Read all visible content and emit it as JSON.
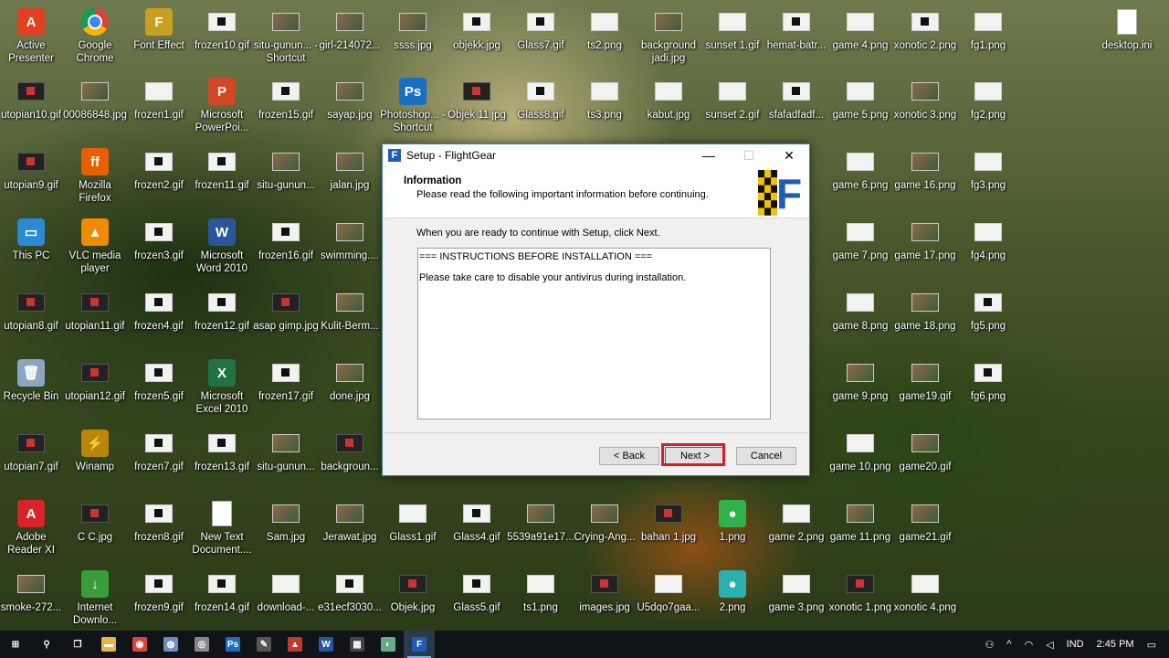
{
  "desktop": {
    "icons": [
      {
        "label": "Active Presenter",
        "kind": "app",
        "color": "#e04020",
        "glyph": "A"
      },
      {
        "label": "Google Chrome",
        "kind": "chrome"
      },
      {
        "label": "Font Effect",
        "kind": "app",
        "color": "#c8a020",
        "glyph": "F"
      },
      {
        "label": "frozen10.gif",
        "kind": "gif"
      },
      {
        "label": "situ-gunun... - Shortcut",
        "kind": "photo"
      },
      {
        "label": "girl-214072...",
        "kind": "photo"
      },
      {
        "label": "ssss.jpg",
        "kind": "photo"
      },
      {
        "label": "objekk.jpg",
        "kind": "gif"
      },
      {
        "label": "Glass7.gif",
        "kind": "gif"
      },
      {
        "label": "ts2.png",
        "kind": "png"
      },
      {
        "label": "background jadi.jpg",
        "kind": "photo"
      },
      {
        "label": "sunset 1.gif",
        "kind": "png"
      },
      {
        "label": "hemat-batr...",
        "kind": "gif"
      },
      {
        "label": "game 4.png",
        "kind": "png"
      },
      {
        "label": "xonotic 2.png",
        "kind": "gif"
      },
      {
        "label": "fg1.png",
        "kind": "png"
      },
      {
        "label": "desktop.ini",
        "kind": "file"
      },
      {
        "label": "utopian10.gif",
        "kind": "dark"
      },
      {
        "label": "00086848.jpg",
        "kind": "photo"
      },
      {
        "label": "frozen1.gif",
        "kind": "png"
      },
      {
        "label": "Microsoft PowerPoi...",
        "kind": "app",
        "color": "#d24726",
        "glyph": "P"
      },
      {
        "label": "frozen15.gif",
        "kind": "gif"
      },
      {
        "label": "sayap.jpg",
        "kind": "photo"
      },
      {
        "label": "Photoshop... - Shortcut",
        "kind": "app",
        "color": "#1a6fc4",
        "glyph": "Ps"
      },
      {
        "label": "Objek 11.jpg",
        "kind": "dark"
      },
      {
        "label": "Glass8.gif",
        "kind": "gif"
      },
      {
        "label": "ts3.png",
        "kind": "png"
      },
      {
        "label": "kabut.jpg",
        "kind": "png"
      },
      {
        "label": "sunset 2.gif",
        "kind": "png"
      },
      {
        "label": "sfafadfadf...",
        "kind": "gif"
      },
      {
        "label": "game 5.png",
        "kind": "png"
      },
      {
        "label": "xonotic 3.png",
        "kind": "photo"
      },
      {
        "label": "fg2.png",
        "kind": "png"
      },
      {
        "label": "utopian9.gif",
        "kind": "dark"
      },
      {
        "label": "Mozilla Firefox",
        "kind": "app",
        "color": "#e66000",
        "glyph": "ff"
      },
      {
        "label": "frozen2.gif",
        "kind": "gif"
      },
      {
        "label": "frozen11.gif",
        "kind": "gif"
      },
      {
        "label": "situ-gunun...",
        "kind": "photo"
      },
      {
        "label": "jalan.jpg",
        "kind": "photo"
      },
      {
        "label": "game 6.png",
        "kind": "png"
      },
      {
        "label": "game 16.png",
        "kind": "photo"
      },
      {
        "label": "fg3.png",
        "kind": "png"
      },
      {
        "label": "This PC",
        "kind": "app",
        "color": "#2a8ad4",
        "glyph": "▭"
      },
      {
        "label": "VLC media player",
        "kind": "app",
        "color": "#f08a00",
        "glyph": "▲"
      },
      {
        "label": "frozen3.gif",
        "kind": "gif"
      },
      {
        "label": "Microsoft Word 2010",
        "kind": "app",
        "color": "#2b579a",
        "glyph": "W"
      },
      {
        "label": "frozen16.gif",
        "kind": "gif"
      },
      {
        "label": "swimming....",
        "kind": "photo"
      },
      {
        "label": "game 7.png",
        "kind": "png"
      },
      {
        "label": "game 17.png",
        "kind": "photo"
      },
      {
        "label": "fg4.png",
        "kind": "png"
      },
      {
        "label": "utopian8.gif",
        "kind": "dark"
      },
      {
        "label": "utopian11.gif",
        "kind": "dark"
      },
      {
        "label": "frozen4.gif",
        "kind": "gif"
      },
      {
        "label": "frozen12.gif",
        "kind": "gif"
      },
      {
        "label": "asap gimp.jpg",
        "kind": "dark"
      },
      {
        "label": "Kulit-Berm...",
        "kind": "photo"
      },
      {
        "label": "game 8.png",
        "kind": "png"
      },
      {
        "label": "game 18.png",
        "kind": "photo"
      },
      {
        "label": "fg5.png",
        "kind": "gif"
      },
      {
        "label": "Recycle Bin",
        "kind": "app",
        "color": "#8aa6c0",
        "glyph": "🗑"
      },
      {
        "label": "utopian12.gif",
        "kind": "dark"
      },
      {
        "label": "frozen5.gif",
        "kind": "gif"
      },
      {
        "label": "Microsoft Excel 2010",
        "kind": "app",
        "color": "#217346",
        "glyph": "X"
      },
      {
        "label": "frozen17.gif",
        "kind": "gif"
      },
      {
        "label": "done.jpg",
        "kind": "photo"
      },
      {
        "label": "game 9.png",
        "kind": "photo"
      },
      {
        "label": "game19.gif",
        "kind": "photo"
      },
      {
        "label": "fg6.png",
        "kind": "gif"
      },
      {
        "label": "utopian7.gif",
        "kind": "dark"
      },
      {
        "label": "Winamp",
        "kind": "app",
        "color": "#b8860b",
        "glyph": "⚡"
      },
      {
        "label": "frozen7.gif",
        "kind": "gif"
      },
      {
        "label": "frozen13.gif",
        "kind": "gif"
      },
      {
        "label": "situ-gunun...",
        "kind": "photo"
      },
      {
        "label": "backgroun...",
        "kind": "dark"
      },
      {
        "label": "game 10.png",
        "kind": "png"
      },
      {
        "label": "game20.gif",
        "kind": "photo"
      },
      {
        "label": "Adobe Reader XI",
        "kind": "app",
        "color": "#d8232a",
        "glyph": "A"
      },
      {
        "label": "C C.jpg",
        "kind": "dark"
      },
      {
        "label": "frozen8.gif",
        "kind": "gif"
      },
      {
        "label": "New Text Document....",
        "kind": "file"
      },
      {
        "label": "Sam.jpg",
        "kind": "photo"
      },
      {
        "label": "Jerawat.jpg",
        "kind": "photo"
      },
      {
        "label": "Glass1.gif",
        "kind": "png"
      },
      {
        "label": "Glass4.gif",
        "kind": "gif"
      },
      {
        "label": "5539a91e17...",
        "kind": "photo"
      },
      {
        "label": "Crying-Ang...",
        "kind": "photo"
      },
      {
        "label": "bahan 1.jpg",
        "kind": "dark"
      },
      {
        "label": "1.png",
        "kind": "app",
        "color": "#2fb24a",
        "glyph": "●"
      },
      {
        "label": "game 2.png",
        "kind": "png"
      },
      {
        "label": "game 11.png",
        "kind": "photo"
      },
      {
        "label": "game21.gif",
        "kind": "photo"
      },
      {
        "label": "smoke-272...",
        "kind": "photo"
      },
      {
        "label": "Internet Downlo...",
        "kind": "app",
        "color": "#3a9c3a",
        "glyph": "↓"
      },
      {
        "label": "frozen9.gif",
        "kind": "gif"
      },
      {
        "label": "frozen14.gif",
        "kind": "gif"
      },
      {
        "label": "download-...",
        "kind": "png"
      },
      {
        "label": "e31ecf3030...",
        "kind": "gif"
      },
      {
        "label": "Objek.jpg",
        "kind": "dark"
      },
      {
        "label": "Glass5.gif",
        "kind": "gif"
      },
      {
        "label": "ts1.png",
        "kind": "png"
      },
      {
        "label": "images.jpg",
        "kind": "dark"
      },
      {
        "label": "U5dqo7gaa...",
        "kind": "png"
      },
      {
        "label": "2.png",
        "kind": "app",
        "color": "#2ab0b0",
        "glyph": "●"
      },
      {
        "label": "game 3.png",
        "kind": "png"
      },
      {
        "label": "xonotic 1.png",
        "kind": "dark"
      },
      {
        "label": "xonotic 4.png",
        "kind": "png"
      }
    ]
  },
  "dialog": {
    "title": "Setup - FlightGear",
    "icon_letter": "F",
    "controls": {
      "minimize": "—",
      "maximize": "☐",
      "close": "✕"
    },
    "header_title": "Information",
    "header_subtitle": "Please read the following important information before continuing.",
    "intro": "When you are ready to continue with Setup, click Next.",
    "memo_lines": [
      "=== INSTRUCTIONS BEFORE INSTALLATION ===",
      "Please take care to disable your antivirus during installation."
    ],
    "buttons": {
      "back": "< Back",
      "next": "Next >",
      "cancel": "Cancel"
    },
    "logo_letter": "F",
    "highlight_color": "#e11b22"
  },
  "taskbar": {
    "items": [
      {
        "name": "start-button",
        "glyph": "⊞",
        "color": "#101418"
      },
      {
        "name": "search-icon",
        "glyph": "⚲",
        "color": "#101418"
      },
      {
        "name": "task-view-icon",
        "glyph": "❐",
        "color": "#101418"
      },
      {
        "name": "file-explorer-icon",
        "glyph": "▬",
        "color": "#e8b640"
      },
      {
        "name": "chrome-icon",
        "glyph": "◉",
        "color": "#db4437"
      },
      {
        "name": "app-icon-1",
        "glyph": "◍",
        "color": "#6c8ebf"
      },
      {
        "name": "app-icon-2",
        "glyph": "◎",
        "color": "#888"
      },
      {
        "name": "photoshop-icon",
        "glyph": "Ps",
        "color": "#1a6fc4"
      },
      {
        "name": "app-icon-3",
        "glyph": "✎",
        "color": "#555"
      },
      {
        "name": "app-icon-4",
        "glyph": "▲",
        "color": "#c0392b"
      },
      {
        "name": "word-icon",
        "glyph": "W",
        "color": "#2b579a"
      },
      {
        "name": "photos-icon",
        "glyph": "▦",
        "color": "#444"
      },
      {
        "name": "app-icon-5",
        "glyph": "◐",
        "color": "#6a8"
      },
      {
        "name": "flightgear-icon",
        "glyph": "F",
        "color": "#1e5db3",
        "active": true
      }
    ],
    "tray": {
      "language": "IND",
      "time": "2:45 PM"
    }
  }
}
